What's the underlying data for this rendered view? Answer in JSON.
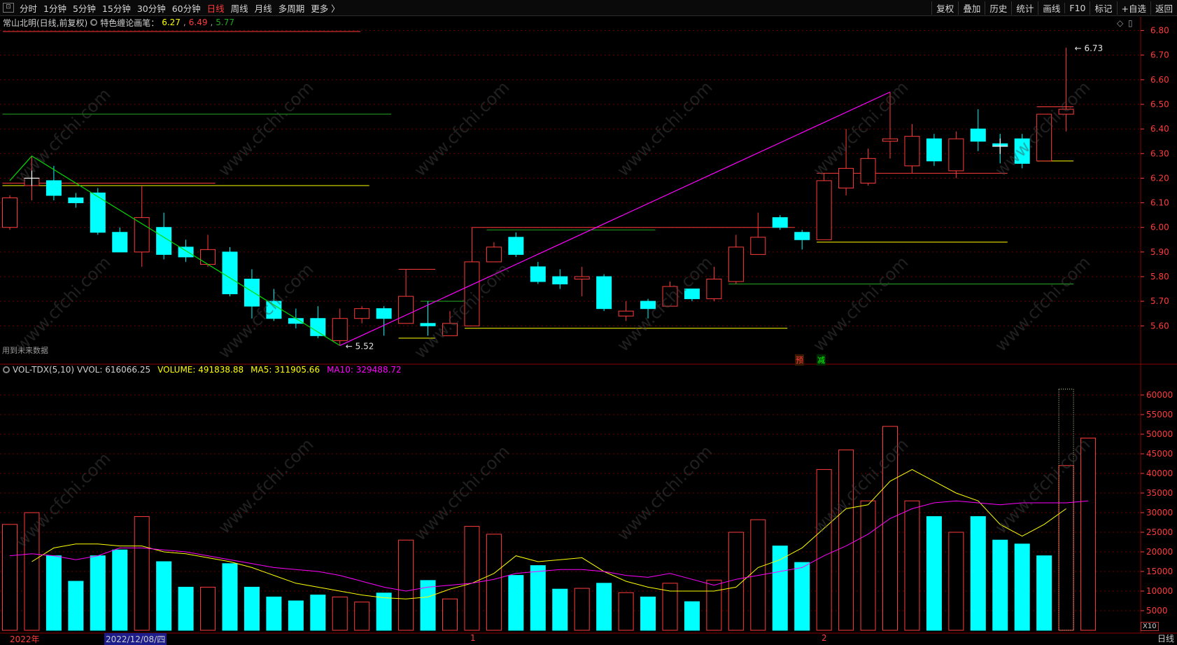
{
  "toolbar": {
    "periods": [
      "分时",
      "1分钟",
      "5分钟",
      "15分钟",
      "30分钟",
      "60分钟",
      "日线",
      "周线",
      "月线",
      "多周期",
      "更多 〉"
    ],
    "active_period": "日线",
    "tools": [
      "复权",
      "叠加",
      "历史",
      "统计",
      "画线",
      "F10",
      "标记",
      "+自选",
      "返回"
    ]
  },
  "price_panel": {
    "stock_title": "常山北明(日线,前复权)",
    "indicator_name": "特色缠论画笔：",
    "indicator_values": [
      "6.27",
      "6.49",
      "5.77"
    ],
    "indicator_colors": [
      "#ffff00",
      "#ff3b3b",
      "#22aa22"
    ],
    "future_data_note": "用到未来数据",
    "axis_ticks": [
      "6.80",
      "6.70",
      "6.60",
      "6.50",
      "6.40",
      "6.30",
      "6.20",
      "6.10",
      "6.00",
      "5.90",
      "5.80",
      "5.70",
      "5.60"
    ],
    "high_label": "6.73",
    "low_label": "5.52",
    "pred_labels": [
      "预",
      "减"
    ]
  },
  "volume_panel": {
    "label": "VOL-TDX(5,10)",
    "vvol": "VVOL: 616066.25",
    "volume": "VOLUME: 491838.88",
    "ma5": "MA5: 311905.66",
    "ma10": "MA10: 329488.72",
    "axis_ticks": [
      "60000",
      "55000",
      "50000",
      "45000",
      "40000",
      "35000",
      "30000",
      "25000",
      "20000",
      "15000",
      "10000",
      "5000"
    ],
    "scale_note": "X10"
  },
  "bottom": {
    "year_label": "2022年",
    "date_label": "2022/12/08/四",
    "month_labels": [
      "1",
      "2"
    ],
    "period_label": "日线"
  },
  "watermark": "www.cfchi.com",
  "colors": {
    "up": "#ff3b3b",
    "down": "#00ffff",
    "ma5": "#ffff00",
    "ma10": "#ff00ff",
    "grid": "#6a0000",
    "axis_text": "#ff3b3b",
    "bi_green": "#00dd00",
    "bi_magenta": "#ff00ff"
  },
  "chart_data": [
    {
      "type": "candlestick",
      "title": "常山北明(日线,前复权)",
      "ylim": [
        5.45,
        6.85
      ],
      "candles": [
        {
          "o": 6.0,
          "c": 6.12,
          "h": 6.13,
          "l": 5.99
        },
        {
          "o": 6.17,
          "c": 6.2,
          "h": 6.29,
          "l": 6.11
        },
        {
          "o": 6.19,
          "c": 6.13,
          "h": 6.25,
          "l": 6.11
        },
        {
          "o": 6.12,
          "c": 6.1,
          "h": 6.14,
          "l": 6.08
        },
        {
          "o": 6.14,
          "c": 5.98,
          "h": 6.16,
          "l": 5.97
        },
        {
          "o": 5.98,
          "c": 5.9,
          "h": 6.0,
          "l": 5.9
        },
        {
          "o": 5.9,
          "c": 6.04,
          "h": 6.17,
          "l": 5.84
        },
        {
          "o": 6.0,
          "c": 5.89,
          "h": 6.06,
          "l": 5.87
        },
        {
          "o": 5.92,
          "c": 5.88,
          "h": 5.95,
          "l": 5.86
        },
        {
          "o": 5.85,
          "c": 5.91,
          "h": 5.97,
          "l": 5.84
        },
        {
          "o": 5.9,
          "c": 5.73,
          "h": 5.92,
          "l": 5.72
        },
        {
          "o": 5.79,
          "c": 5.68,
          "h": 5.83,
          "l": 5.63
        },
        {
          "o": 5.7,
          "c": 5.63,
          "h": 5.75,
          "l": 5.62
        },
        {
          "o": 5.63,
          "c": 5.61,
          "h": 5.67,
          "l": 5.59
        },
        {
          "o": 5.63,
          "c": 5.56,
          "h": 5.68,
          "l": 5.55
        },
        {
          "o": 5.54,
          "c": 5.63,
          "h": 5.67,
          "l": 5.52
        },
        {
          "o": 5.63,
          "c": 5.67,
          "h": 5.68,
          "l": 5.61
        },
        {
          "o": 5.67,
          "c": 5.63,
          "h": 5.68,
          "l": 5.56
        },
        {
          "o": 5.61,
          "c": 5.72,
          "h": 5.83,
          "l": 5.61
        },
        {
          "o": 5.61,
          "c": 5.6,
          "h": 5.7,
          "l": 5.56
        },
        {
          "o": 5.56,
          "c": 5.61,
          "h": 5.66,
          "l": 5.56
        },
        {
          "o": 5.6,
          "c": 5.86,
          "h": 5.86,
          "l": 5.6
        },
        {
          "o": 5.86,
          "c": 5.92,
          "h": 5.94,
          "l": 5.86
        },
        {
          "o": 5.96,
          "c": 5.89,
          "h": 5.98,
          "l": 5.88
        },
        {
          "o": 5.84,
          "c": 5.78,
          "h": 5.86,
          "l": 5.77
        },
        {
          "o": 5.8,
          "c": 5.77,
          "h": 5.83,
          "l": 5.75
        },
        {
          "o": 5.79,
          "c": 5.8,
          "h": 5.84,
          "l": 5.72
        },
        {
          "o": 5.8,
          "c": 5.67,
          "h": 5.81,
          "l": 5.66
        },
        {
          "o": 5.64,
          "c": 5.66,
          "h": 5.7,
          "l": 5.62
        },
        {
          "o": 5.7,
          "c": 5.67,
          "h": 5.71,
          "l": 5.63
        },
        {
          "o": 5.68,
          "c": 5.76,
          "h": 5.78,
          "l": 5.68
        },
        {
          "o": 5.75,
          "c": 5.71,
          "h": 5.75,
          "l": 5.7
        },
        {
          "o": 5.71,
          "c": 5.79,
          "h": 5.84,
          "l": 5.7
        },
        {
          "o": 5.78,
          "c": 5.92,
          "h": 5.97,
          "l": 5.77
        },
        {
          "o": 5.89,
          "c": 5.96,
          "h": 6.06,
          "l": 5.89
        },
        {
          "o": 6.04,
          "c": 6.0,
          "h": 6.05,
          "l": 5.99
        },
        {
          "o": 5.98,
          "c": 5.95,
          "h": 5.99,
          "l": 5.91
        },
        {
          "o": 5.95,
          "c": 6.19,
          "h": 6.22,
          "l": 5.95
        },
        {
          "o": 6.16,
          "c": 6.24,
          "h": 6.4,
          "l": 6.13
        },
        {
          "o": 6.18,
          "c": 6.28,
          "h": 6.32,
          "l": 6.17
        },
        {
          "o": 6.35,
          "c": 6.36,
          "h": 6.55,
          "l": 6.28
        },
        {
          "o": 6.25,
          "c": 6.37,
          "h": 6.42,
          "l": 6.22
        },
        {
          "o": 6.36,
          "c": 6.27,
          "h": 6.38,
          "l": 6.25
        },
        {
          "o": 6.23,
          "c": 6.36,
          "h": 6.39,
          "l": 6.2
        },
        {
          "o": 6.4,
          "c": 6.35,
          "h": 6.48,
          "l": 6.31
        },
        {
          "o": 6.34,
          "c": 6.33,
          "h": 6.38,
          "l": 6.26
        },
        {
          "o": 6.36,
          "c": 6.26,
          "h": 6.38,
          "l": 6.24
        },
        {
          "o": 6.27,
          "c": 6.46,
          "h": 6.46,
          "l": 6.27
        },
        {
          "o": 6.46,
          "c": 6.48,
          "h": 6.73,
          "l": 6.39
        }
      ],
      "bi_lines": [
        {
          "color": "#00dd00",
          "points": [
            [
              0,
              6.19
            ],
            [
              1,
              6.29
            ],
            [
              15,
              5.52
            ]
          ]
        },
        {
          "color": "#ff00ff",
          "points": [
            [
              15,
              5.52
            ],
            [
              40,
              6.55
            ]
          ]
        }
      ],
      "pivot_boxes": [
        {
          "color": "#ff3b3b",
          "x0": 21,
          "x1": 35,
          "y0": 6.0,
          "y1": 5.6
        }
      ],
      "level_lines": [
        {
          "color": "#22aa22",
          "x0": 0,
          "x1": 17,
          "y": 6.46
        },
        {
          "color": "#ffff00",
          "x0": 0,
          "x1": 16,
          "y": 6.17
        },
        {
          "color": "#ff3b3b",
          "x0": 0,
          "x1": 9,
          "y": 6.18
        },
        {
          "color": "#ffff00",
          "x0": 21,
          "x1": 35,
          "y": 5.59
        },
        {
          "color": "#22aa22",
          "x0": 22,
          "x1": 29,
          "y": 5.99
        },
        {
          "color": "#22aa22",
          "x0": 19,
          "x1": 21,
          "y": 5.7
        },
        {
          "color": "#ff3b3b",
          "x0": 18,
          "x1": 19,
          "y": 5.83
        },
        {
          "color": "#ffff00",
          "x0": 18,
          "x1": 19,
          "y": 5.55
        },
        {
          "color": "#22aa22",
          "x0": 33,
          "x1": 48,
          "y": 5.77
        },
        {
          "color": "#ffff00",
          "x0": 37,
          "x1": 45,
          "y": 5.94
        },
        {
          "color": "#ff3b3b",
          "x0": 37,
          "x1": 45,
          "y": 6.22
        },
        {
          "color": "#ffff00",
          "x0": 47,
          "x1": 48,
          "y": 6.27
        },
        {
          "color": "#ff3b3b",
          "x0": 47,
          "x1": 48,
          "y": 6.49
        }
      ]
    },
    {
      "type": "bar",
      "title": "VOL-TDX(5,10)",
      "ylim": [
        0,
        65000
      ],
      "values": [
        27000,
        30000,
        19000,
        12500,
        19000,
        20500,
        29000,
        17500,
        11000,
        11000,
        17000,
        11000,
        8500,
        7500,
        9000,
        8500,
        7200,
        9500,
        23000,
        12700,
        8000,
        26500,
        24500,
        14000,
        16500,
        10500,
        10700,
        12000,
        9600,
        8500,
        12000,
        7300,
        12800,
        25000,
        28200,
        21500,
        17300,
        41000,
        46000,
        33000,
        52000,
        33000,
        29000,
        25000,
        29000,
        23000,
        22000,
        19000,
        42000,
        49000
      ],
      "up": [
        true,
        true,
        false,
        false,
        false,
        false,
        true,
        false,
        false,
        true,
        false,
        false,
        false,
        false,
        false,
        true,
        true,
        false,
        true,
        false,
        true,
        true,
        true,
        false,
        false,
        false,
        true,
        false,
        true,
        false,
        true,
        false,
        true,
        true,
        true,
        false,
        false,
        true,
        true,
        true,
        true,
        true,
        false,
        true,
        false,
        false,
        false,
        false,
        true,
        true
      ],
      "predicted_last": 61500,
      "ma5": [
        17500,
        21000,
        22000,
        22000,
        21500,
        21500,
        20000,
        19500,
        18500,
        17500,
        16000,
        14000,
        12000,
        11000,
        10000,
        9000,
        8300,
        8000,
        8500,
        10500,
        12000,
        14500,
        19000,
        17500,
        18000,
        18500,
        15000,
        12500,
        11000,
        10000,
        10000,
        10000,
        11000,
        16000,
        18000,
        21000,
        26000,
        31000,
        32000,
        38000,
        41000,
        38000,
        35000,
        33000,
        27000,
        24000,
        27000,
        31000
      ],
      "ma10": [
        19000,
        19500,
        19000,
        18000,
        19000,
        21000,
        21000,
        20500,
        20000,
        19000,
        18000,
        17000,
        16000,
        15500,
        15000,
        14000,
        12500,
        11000,
        10000,
        11000,
        11500,
        12000,
        13000,
        14500,
        15000,
        15500,
        15500,
        15000,
        14000,
        13500,
        14500,
        13000,
        11500,
        13000,
        14000,
        15000,
        16000,
        19000,
        21500,
        24500,
        28500,
        31000,
        32500,
        33000,
        32500,
        32000,
        32500,
        32500,
        32500,
        33000
      ]
    }
  ]
}
